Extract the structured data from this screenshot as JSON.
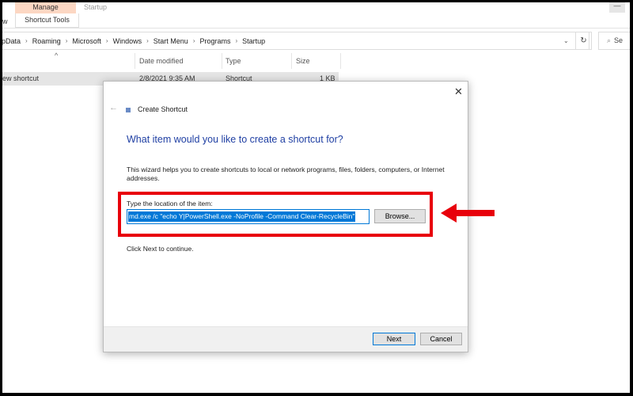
{
  "ribbon": {
    "manage_tab": "Manage",
    "location_tab": "Startup",
    "tools_tab": "Shortcut Tools",
    "left_fragment": "w"
  },
  "window_controls": {
    "minimize": "—"
  },
  "address": {
    "crumbs": [
      "pData",
      "Roaming",
      "Microsoft",
      "Windows",
      "Start Menu",
      "Programs",
      "Startup"
    ],
    "separator": "›",
    "dropdown": "⌄",
    "refresh": "↻",
    "search_icon": "⌕",
    "search_placeholder": "Se"
  },
  "columns": {
    "sort_caret": "^",
    "headers": [
      "Date modified",
      "Type",
      "Size"
    ]
  },
  "files": [
    {
      "name": "ew shortcut",
      "date": "2/8/2021 9:35 AM",
      "type": "Shortcut",
      "size": "1 KB"
    }
  ],
  "dialog": {
    "close": "✕",
    "back": "←",
    "title": "Create Shortcut",
    "heading": "What item would you like to create a shortcut for?",
    "description": "This wizard helps you to create shortcuts to local or network programs, files, folders, computers, or Internet addresses.",
    "location_label": "Type the location of the item:",
    "location_value": "md.exe /c \"echo Y|PowerShell.exe -NoProfile -Command Clear-RecycleBin\"",
    "browse": "Browse...",
    "continue_hint": "Click Next to continue.",
    "next": "Next",
    "cancel": "Cancel"
  },
  "annotation": {
    "highlight_color": "#e8000b"
  }
}
